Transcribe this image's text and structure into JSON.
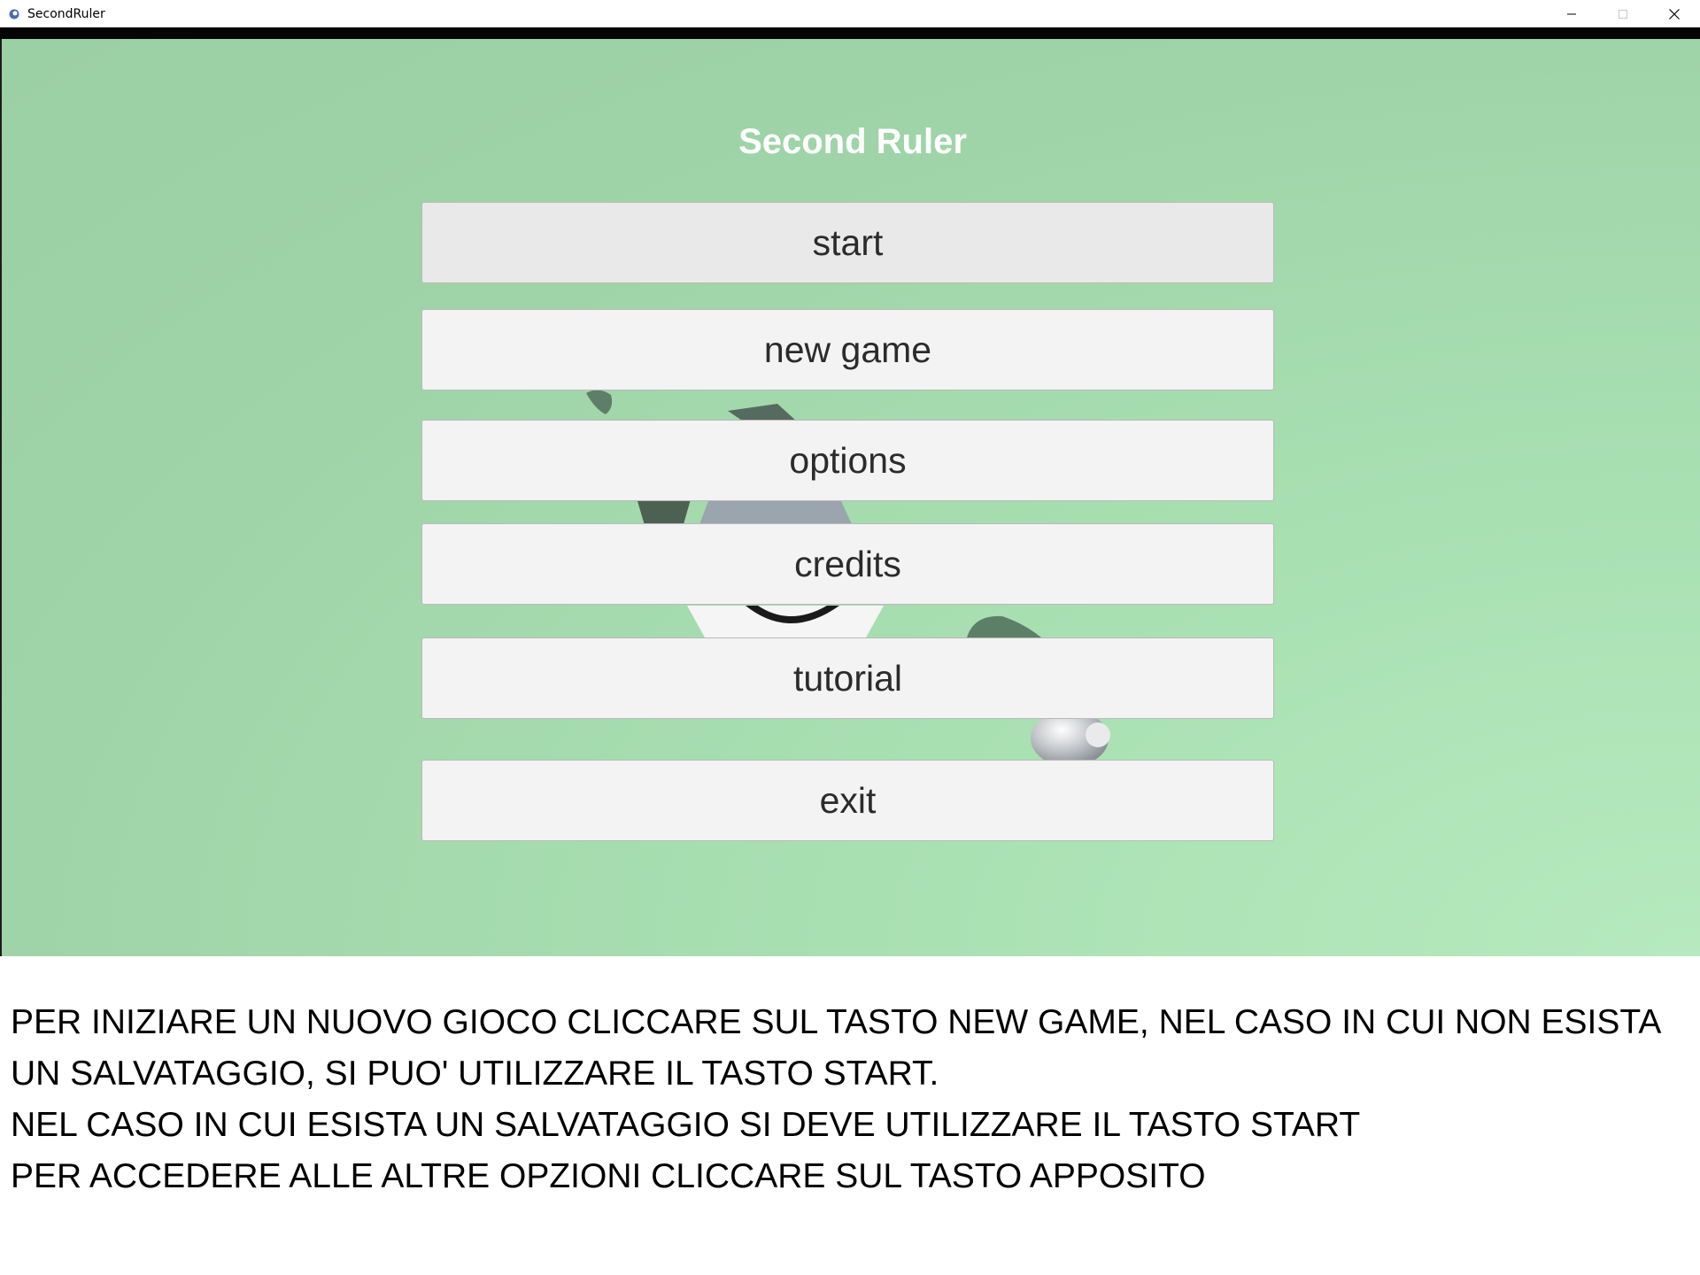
{
  "window": {
    "title": "SecondRuler",
    "controls": {
      "minimize": "minimize-icon",
      "maximize": "maximize-icon",
      "close": "close-icon"
    }
  },
  "game": {
    "title": "Second Ruler",
    "menu": {
      "start": "start",
      "new_game": "new game",
      "options": "options",
      "credits": "credits",
      "tutorial": "tutorial",
      "exit": "exit"
    }
  },
  "instructions": {
    "line1": "PER INIZIARE UN NUOVO GIOCO CLICCARE SUL TASTO NEW GAME, NEL CASO IN CUI NON ESISTA",
    "line2": "UN SALVATAGGIO, SI PUO' UTILIZZARE IL TASTO START.",
    "line3": "NEL CASO IN CUI ESISTA UN SALVATAGGIO SI DEVE UTILIZZARE IL TASTO START",
    "line4": "PER ACCEDERE ALLE ALTRE OPZIONI CLICCARE SUL TASTO APPOSITO"
  },
  "colors": {
    "background_green": "#9fd4a8",
    "button_fill": "#f3f3f3",
    "button_text": "#2b2b2b",
    "title_text": "#ffffff"
  }
}
